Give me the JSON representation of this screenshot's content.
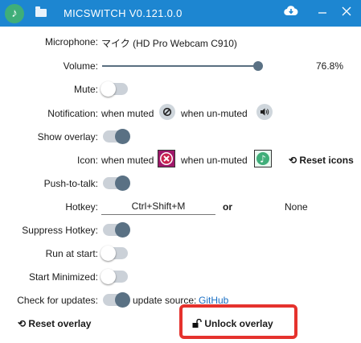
{
  "window": {
    "title": "MICSWITCH V0.121.0.0"
  },
  "microphone": {
    "label": "Microphone:",
    "value": "マイク (HD Pro Webcam C910)"
  },
  "volume": {
    "label": "Volume:",
    "value_text": "76.8%",
    "value": 0.768
  },
  "mute": {
    "label": "Mute:",
    "on": false
  },
  "notification": {
    "label": "Notification:",
    "when_muted": "when muted",
    "when_unmuted": "when un-muted"
  },
  "show_overlay": {
    "label": "Show overlay:",
    "on": true
  },
  "icon": {
    "label": "Icon:",
    "when_muted": "when muted",
    "when_unmuted": "when un-muted",
    "reset_label": "Reset icons"
  },
  "push_to_talk": {
    "label": "Push-to-talk:",
    "on": true
  },
  "hotkey": {
    "label": "Hotkey:",
    "value": "Ctrl+Shift+M",
    "or": "or",
    "alt_value": "None"
  },
  "suppress_hotkey": {
    "label": "Suppress Hotkey:",
    "on": true
  },
  "run_at_start": {
    "label": "Run at start:",
    "on": false
  },
  "start_minimized": {
    "label": "Start Minimized:",
    "on": false
  },
  "check_updates": {
    "label": "Check for updates:",
    "on": true,
    "source_label": "update source:",
    "source_link": "GitHub"
  },
  "actions": {
    "reset_overlay": "Reset overlay",
    "unlock_overlay": "Unlock overlay"
  },
  "colors": {
    "titlebar": "#1d86d1",
    "highlight": "#e5322d",
    "toggle_on": "#5a7184",
    "muted_icon": "#a0186a",
    "unmuted_icon": "#3fae79"
  }
}
